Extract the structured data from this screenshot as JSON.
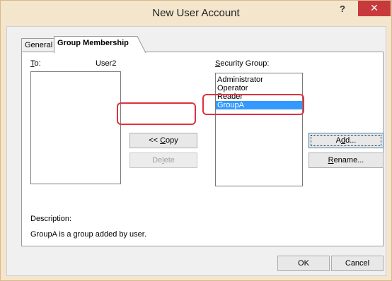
{
  "window": {
    "title": "New User Account",
    "help_label": "?",
    "close_label": "✕"
  },
  "tabs": [
    {
      "label": "General",
      "active": false
    },
    {
      "label": "Group Membership",
      "active": true
    }
  ],
  "to": {
    "label_prefix": "T",
    "label_underlined": "",
    "label_suffix": "o:",
    "user": "User2",
    "items": []
  },
  "security_group": {
    "label_prefix": "",
    "label_underlined": "S",
    "label_suffix": "ecurity Group:",
    "items": [
      "Administrator",
      "Operator",
      "Reader",
      "GroupA"
    ],
    "selected": "GroupA"
  },
  "buttons": {
    "copy_prefix": "<< ",
    "copy_underlined": "C",
    "copy_suffix": "opy",
    "delete_prefix": "De",
    "delete_underlined": "l",
    "delete_suffix": "ete",
    "add_prefix": "A",
    "add_underlined": "d",
    "add_suffix": "d...",
    "rename_prefix": "",
    "rename_underlined": "R",
    "rename_suffix": "ename...",
    "ok": "OK",
    "cancel": "Cancel"
  },
  "description": {
    "label": "Description:",
    "text": "GroupA is a group added by user."
  },
  "colors": {
    "highlight": "#e0323c",
    "selection": "#3399ff",
    "close_button": "#c8393b"
  }
}
